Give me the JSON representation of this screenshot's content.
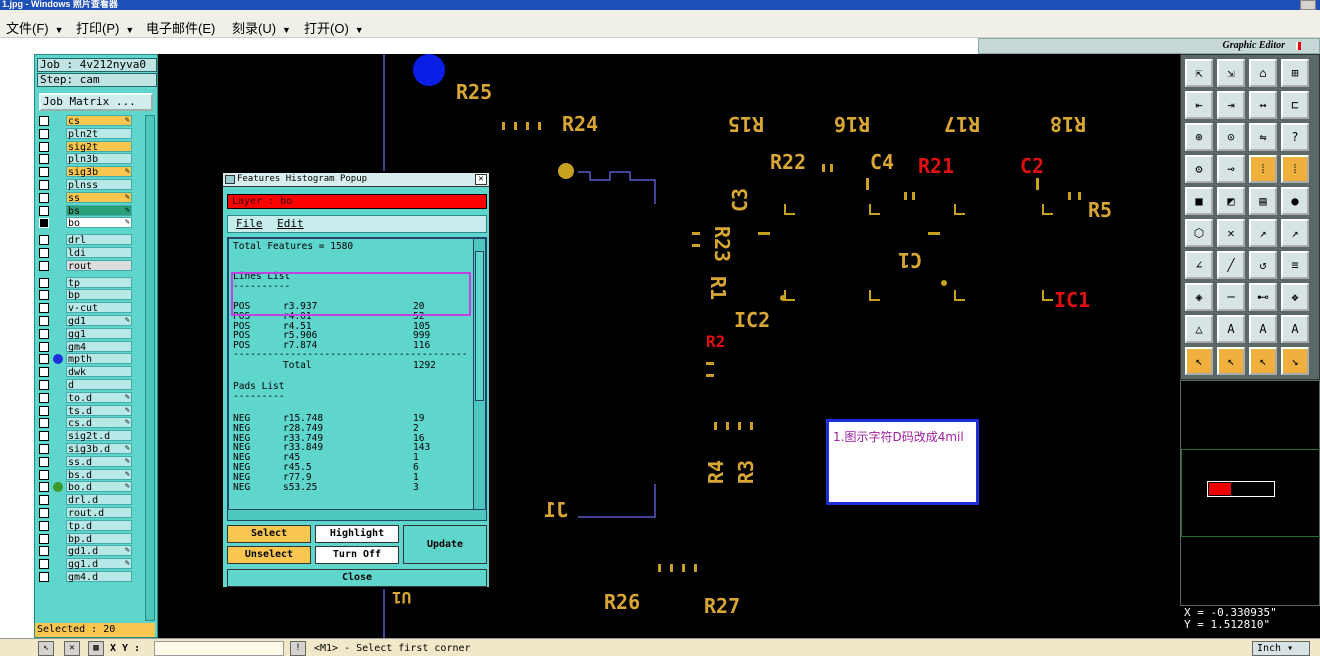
{
  "window": {
    "title": "1.jpg - Windows 照片查看器"
  },
  "menu": [
    {
      "label": "文件(F)"
    },
    {
      "label": "打印(P)"
    },
    {
      "label": "电子邮件(E)"
    },
    {
      "label": "刻录(U)"
    },
    {
      "label": "打开(O)"
    }
  ],
  "editor": {
    "title": "Graphic Editor"
  },
  "job": {
    "job_label": "Job : 4v212nyva0",
    "step_label": "Step: cam",
    "matrix_button": "Job Matrix ..."
  },
  "layers": [
    {
      "name": "cs",
      "color": "#f9c74f",
      "flag": "✎"
    },
    {
      "name": "pln2t",
      "color": "#b8e8e8",
      "flag": ""
    },
    {
      "name": "sig2t",
      "color": "#f9c74f",
      "flag": ""
    },
    {
      "name": "pln3b",
      "color": "#b8e8e8",
      "flag": ""
    },
    {
      "name": "sig3b",
      "color": "#f9c74f",
      "flag": "✎"
    },
    {
      "name": "plnss",
      "color": "#b8e8e8",
      "flag": ""
    },
    {
      "name": "ss",
      "color": "#f9c74f",
      "flag": "✎"
    },
    {
      "name": "bs",
      "color": "#2aa07a",
      "flag": "✎"
    },
    {
      "name": "bo",
      "color": "#ffffff",
      "flag": "✎",
      "active": true
    },
    {
      "name": "drl",
      "color": "#b8e8e8",
      "flag": ""
    },
    {
      "name": "ldi",
      "color": "#b8e8e8",
      "flag": ""
    },
    {
      "name": "rout",
      "color": "#dddddd",
      "flag": ""
    },
    {
      "name": "tp",
      "color": "#b8e8e8",
      "flag": ""
    },
    {
      "name": "bp",
      "color": "#b8e8e8",
      "flag": ""
    },
    {
      "name": "v-cut",
      "color": "#b8e8e8",
      "flag": ""
    },
    {
      "name": "gd1",
      "color": "#b8e8e8",
      "flag": "✎"
    },
    {
      "name": "gg1",
      "color": "#b8e8e8",
      "flag": ""
    },
    {
      "name": "gm4",
      "color": "#b8e8e8",
      "flag": ""
    },
    {
      "name": "mpth",
      "color": "#b8e8e8",
      "flag": "",
      "dot": "#1e2fd8"
    },
    {
      "name": "dwk",
      "color": "#b8e8e8",
      "flag": ""
    },
    {
      "name": "d",
      "color": "#b8e8e8",
      "flag": ""
    },
    {
      "name": "to.d",
      "color": "#b8e8e8",
      "flag": "✎"
    },
    {
      "name": "ts.d",
      "color": "#b8e8e8",
      "flag": "✎"
    },
    {
      "name": "cs.d",
      "color": "#b8e8e8",
      "flag": "✎"
    },
    {
      "name": "sig2t.d",
      "color": "#b8e8e8",
      "flag": ""
    },
    {
      "name": "sig3b.d",
      "color": "#b8e8e8",
      "flag": "✎"
    },
    {
      "name": "ss.d",
      "color": "#b8e8e8",
      "flag": "✎"
    },
    {
      "name": "bs.d",
      "color": "#b8e8e8",
      "flag": "✎"
    },
    {
      "name": "bo.d",
      "color": "#b8e8e8",
      "flag": "✎",
      "dot": "#3a9a2a"
    },
    {
      "name": "drl.d",
      "color": "#b8e8e8",
      "flag": ""
    },
    {
      "name": "rout.d",
      "color": "#b8e8e8",
      "flag": ""
    },
    {
      "name": "tp.d",
      "color": "#b8e8e8",
      "flag": ""
    },
    {
      "name": "bp.d",
      "color": "#b8e8e8",
      "flag": ""
    },
    {
      "name": "gd1.d",
      "color": "#b8e8e8",
      "flag": "✎"
    },
    {
      "name": "gg1.d",
      "color": "#b8e8e8",
      "flag": "✎"
    },
    {
      "name": "gm4.d",
      "color": "#b8e8e8",
      "flag": ""
    }
  ],
  "selected": "Selected : 20",
  "popup": {
    "title": "Features Histogram Popup",
    "layer": "Layer : bo",
    "menu_file": "File",
    "menu_edit": "Edit",
    "total": "Total Features = 1580",
    "lines_header": "Lines List",
    "lines": [
      [
        "POS",
        "r3.937",
        "20"
      ],
      [
        "POS",
        "r4.01",
        "52"
      ],
      [
        "POS",
        "r4.51",
        "105"
      ],
      [
        "POS",
        "r5.906",
        "999"
      ],
      [
        "POS",
        "r7.874",
        "116"
      ]
    ],
    "lines_total_label": "Total",
    "lines_total": "1292",
    "pads_header": "Pads List",
    "pads": [
      [
        "NEG",
        "r15.748",
        "19"
      ],
      [
        "NEG",
        "r28.749",
        "2"
      ],
      [
        "NEG",
        "r33.749",
        "16"
      ],
      [
        "NEG",
        "r33.849",
        "143"
      ],
      [
        "NEG",
        "r45",
        "1"
      ],
      [
        "NEG",
        "r45.5",
        "6"
      ],
      [
        "NEG",
        "r77.9",
        "1"
      ],
      [
        "NEG",
        "s53.25",
        "3"
      ]
    ],
    "btn_select": "Select",
    "btn_unselect": "Unselect",
    "btn_highlight": "Highlight",
    "btn_turnoff": "Turn Off",
    "btn_update": "Update",
    "btn_close": "Close"
  },
  "annotation": "1.图示字符D码改成4mil",
  "pcb_labels": [
    "R25",
    "R24",
    "R15",
    "R16",
    "R17",
    "R18",
    "R22",
    "C4",
    "R21",
    "C2",
    "C3",
    "R5",
    "R23",
    "C1",
    "R1",
    "IC1",
    "IC2",
    "R4",
    "R3",
    "J1",
    "R26",
    "R27",
    "R2",
    "U1"
  ],
  "coords": {
    "x": "X = -0.330935\"",
    "y": "Y = 1.512810\""
  },
  "status": {
    "xy_label": "X Y :",
    "message": "<M1> - Select first corner",
    "units": "Inch"
  }
}
